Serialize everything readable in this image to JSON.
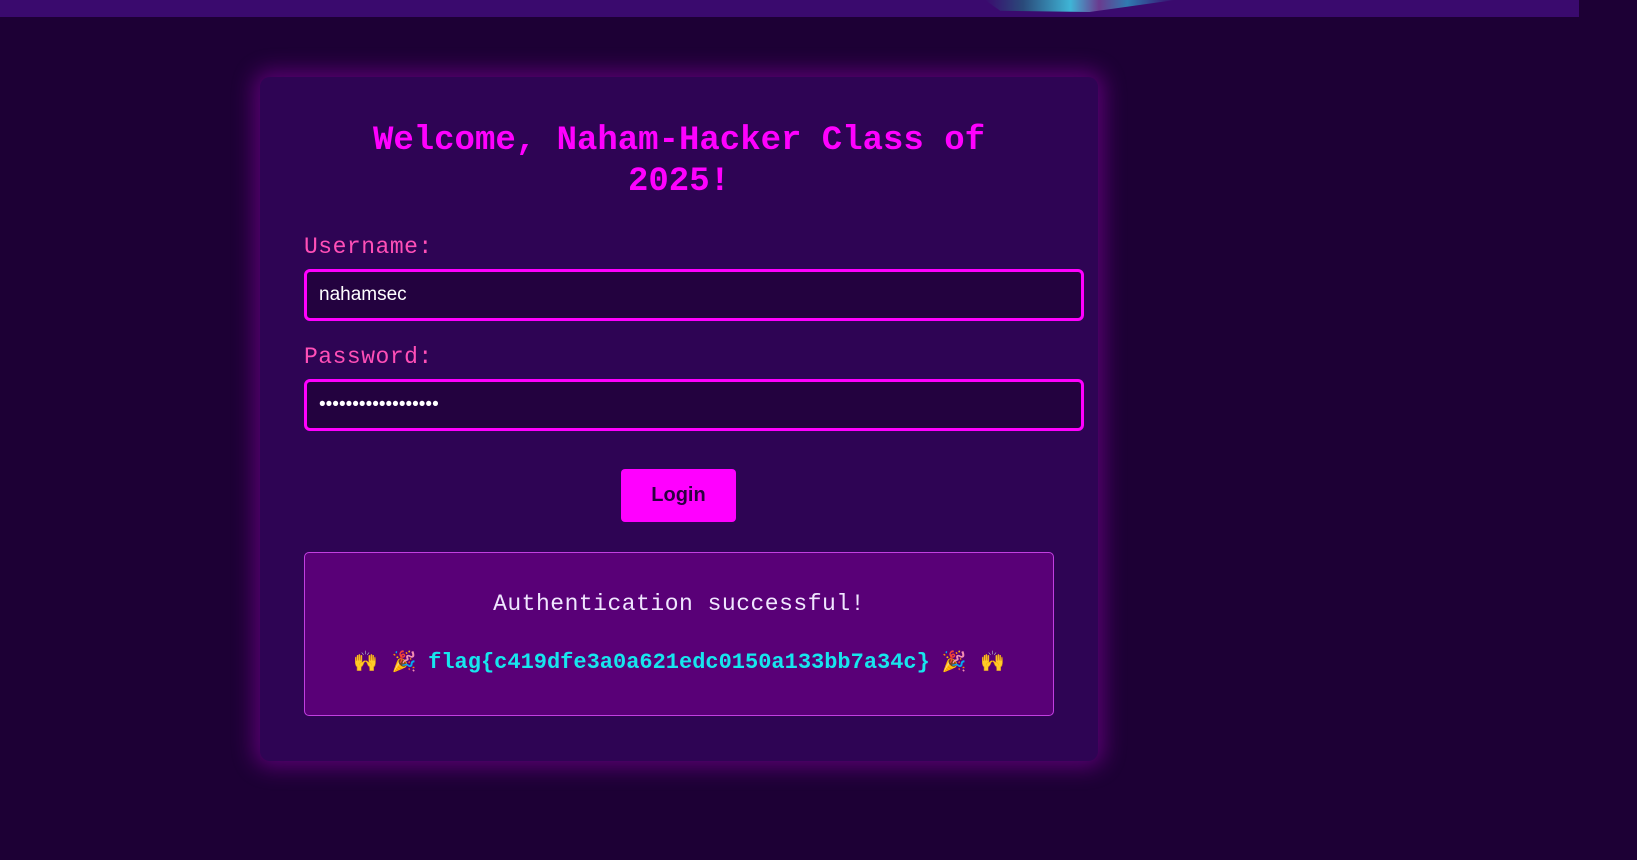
{
  "banner": {
    "art": "banner-artwork"
  },
  "form": {
    "title": "Welcome, Naham-Hacker Class of 2025!",
    "username_label": "Username:",
    "username_value": "nahamsec",
    "password_label": "Password:",
    "password_value": "••••••••••••••••••",
    "login_label": "Login"
  },
  "result": {
    "message": "Authentication successful!",
    "emoji_left_1": "🙌",
    "emoji_left_2": "🎉",
    "flag": "flag{c419dfe3a0a621edc0150a133bb7a34c}",
    "emoji_right_1": "🎉",
    "emoji_right_2": "🙌"
  },
  "colors": {
    "background": "#1d0035",
    "card": "#2e0454",
    "accent": "#ff00ff",
    "label": "#ff4fb7",
    "flag": "#16e6ee"
  }
}
